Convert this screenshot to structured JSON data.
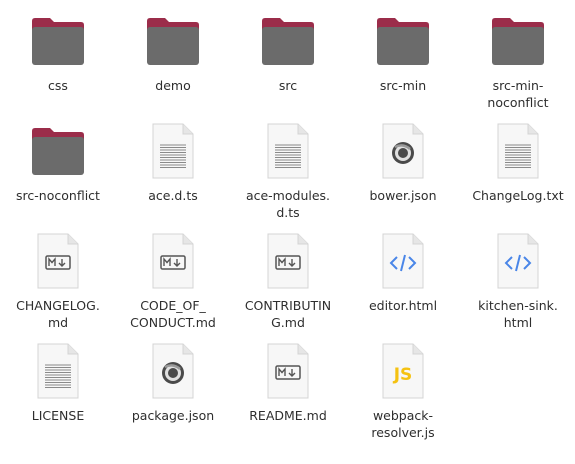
{
  "files": [
    {
      "type": "folder",
      "label_lines": [
        "css"
      ]
    },
    {
      "type": "folder",
      "label_lines": [
        "demo"
      ]
    },
    {
      "type": "folder",
      "label_lines": [
        "src"
      ]
    },
    {
      "type": "folder",
      "label_lines": [
        "src-min"
      ]
    },
    {
      "type": "folder",
      "label_lines": [
        "src-min-",
        "noconflict"
      ]
    },
    {
      "type": "folder",
      "label_lines": [
        "src-noconflict"
      ]
    },
    {
      "type": "text",
      "label_lines": [
        "ace.d.ts"
      ]
    },
    {
      "type": "text",
      "label_lines": [
        "ace-modules.",
        "d.ts"
      ]
    },
    {
      "type": "json",
      "label_lines": [
        "bower.json"
      ]
    },
    {
      "type": "text",
      "label_lines": [
        "ChangeLog.txt"
      ]
    },
    {
      "type": "markdown",
      "label_lines": [
        "CHANGELOG.",
        "md"
      ]
    },
    {
      "type": "markdown",
      "label_lines": [
        "CODE_OF_",
        "CONDUCT.md"
      ]
    },
    {
      "type": "markdown",
      "label_lines": [
        "CONTRIBUTIN",
        "G.md"
      ]
    },
    {
      "type": "html",
      "label_lines": [
        "editor.html"
      ]
    },
    {
      "type": "html",
      "label_lines": [
        "kitchen-sink.",
        "html"
      ]
    },
    {
      "type": "text",
      "label_lines": [
        "LICENSE"
      ]
    },
    {
      "type": "json",
      "label_lines": [
        "package.json"
      ]
    },
    {
      "type": "markdown",
      "label_lines": [
        "README.md"
      ]
    },
    {
      "type": "javascript",
      "label_lines": [
        "webpack-",
        "resolver.js"
      ],
      "badge": "JS"
    }
  ],
  "icons": {
    "folder": "folder-icon",
    "text": "text-file-icon",
    "json": "json-file-icon",
    "markdown": "markdown-file-icon",
    "html": "html-file-icon",
    "javascript": "javascript-file-icon"
  },
  "colors": {
    "folder_body": "#6b6b6b",
    "folder_tab": "#9b2d4a",
    "page": "#f7f7f7",
    "page_border": "#d4d4d4",
    "html_accent": "#4a86e8",
    "js_accent": "#f5c211",
    "label_text": "#2e2e2e"
  }
}
